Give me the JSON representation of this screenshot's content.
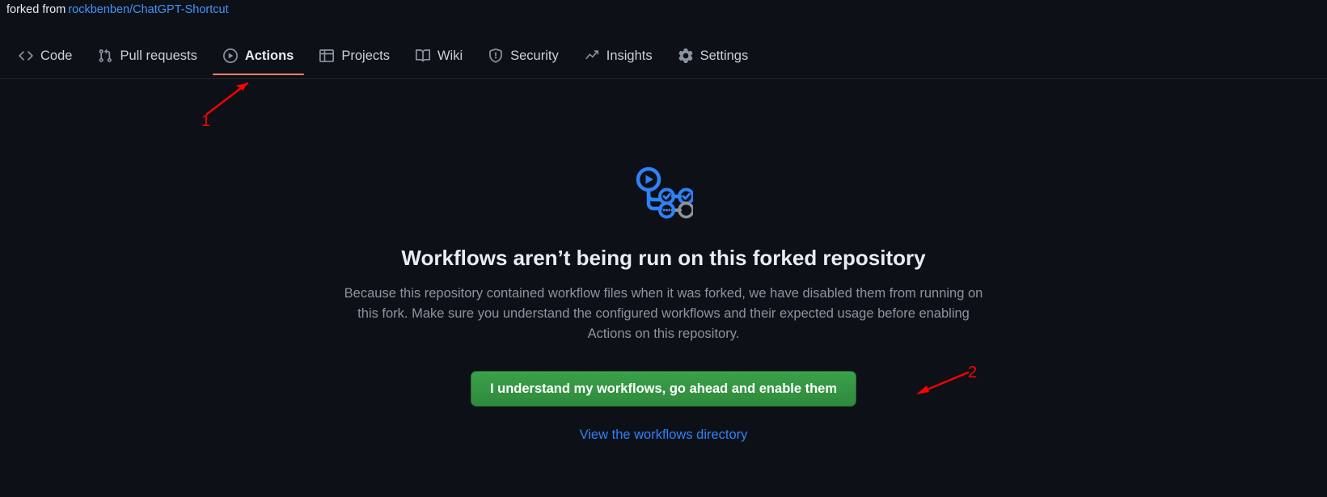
{
  "forked": {
    "label": "forked from",
    "source_repo": "rockbenben/ChatGPT-Shortcut"
  },
  "nav": {
    "items": [
      {
        "label": "Code",
        "icon": "code-icon",
        "active": false
      },
      {
        "label": "Pull requests",
        "icon": "git-pull-request-icon",
        "active": false
      },
      {
        "label": "Actions",
        "icon": "play-circle-icon",
        "active": true
      },
      {
        "label": "Projects",
        "icon": "table-icon",
        "active": false
      },
      {
        "label": "Wiki",
        "icon": "book-icon",
        "active": false
      },
      {
        "label": "Security",
        "icon": "shield-icon",
        "active": false
      },
      {
        "label": "Insights",
        "icon": "graph-icon",
        "active": false
      },
      {
        "label": "Settings",
        "icon": "gear-icon",
        "active": false
      }
    ],
    "active_underline_color": "#f78166"
  },
  "blankslate": {
    "icon": "workflow-icon",
    "heading": "Workflows aren’t being run on this forked repository",
    "body": "Because this repository contained workflow files when it was forked, we have disabled them from running on this fork. Make sure you understand the configured workflows and their expected usage before enabling Actions on this repository.",
    "enable_button_label": "I understand my workflows, go ahead and enable them",
    "enable_button_color": "#2f8a3c",
    "link_label": "View the workflows directory",
    "link_color": "#2f81f7"
  },
  "annotations": [
    {
      "number": "1",
      "color": "#ff0000",
      "points_to": "Actions"
    },
    {
      "number": "2",
      "color": "#ff0000",
      "points_to": "enable-workflows-button"
    }
  ],
  "theme": {
    "background": "#0d1117",
    "text": "#c9d1d9",
    "muted_text": "#8b949e",
    "link": "#4493f8"
  }
}
